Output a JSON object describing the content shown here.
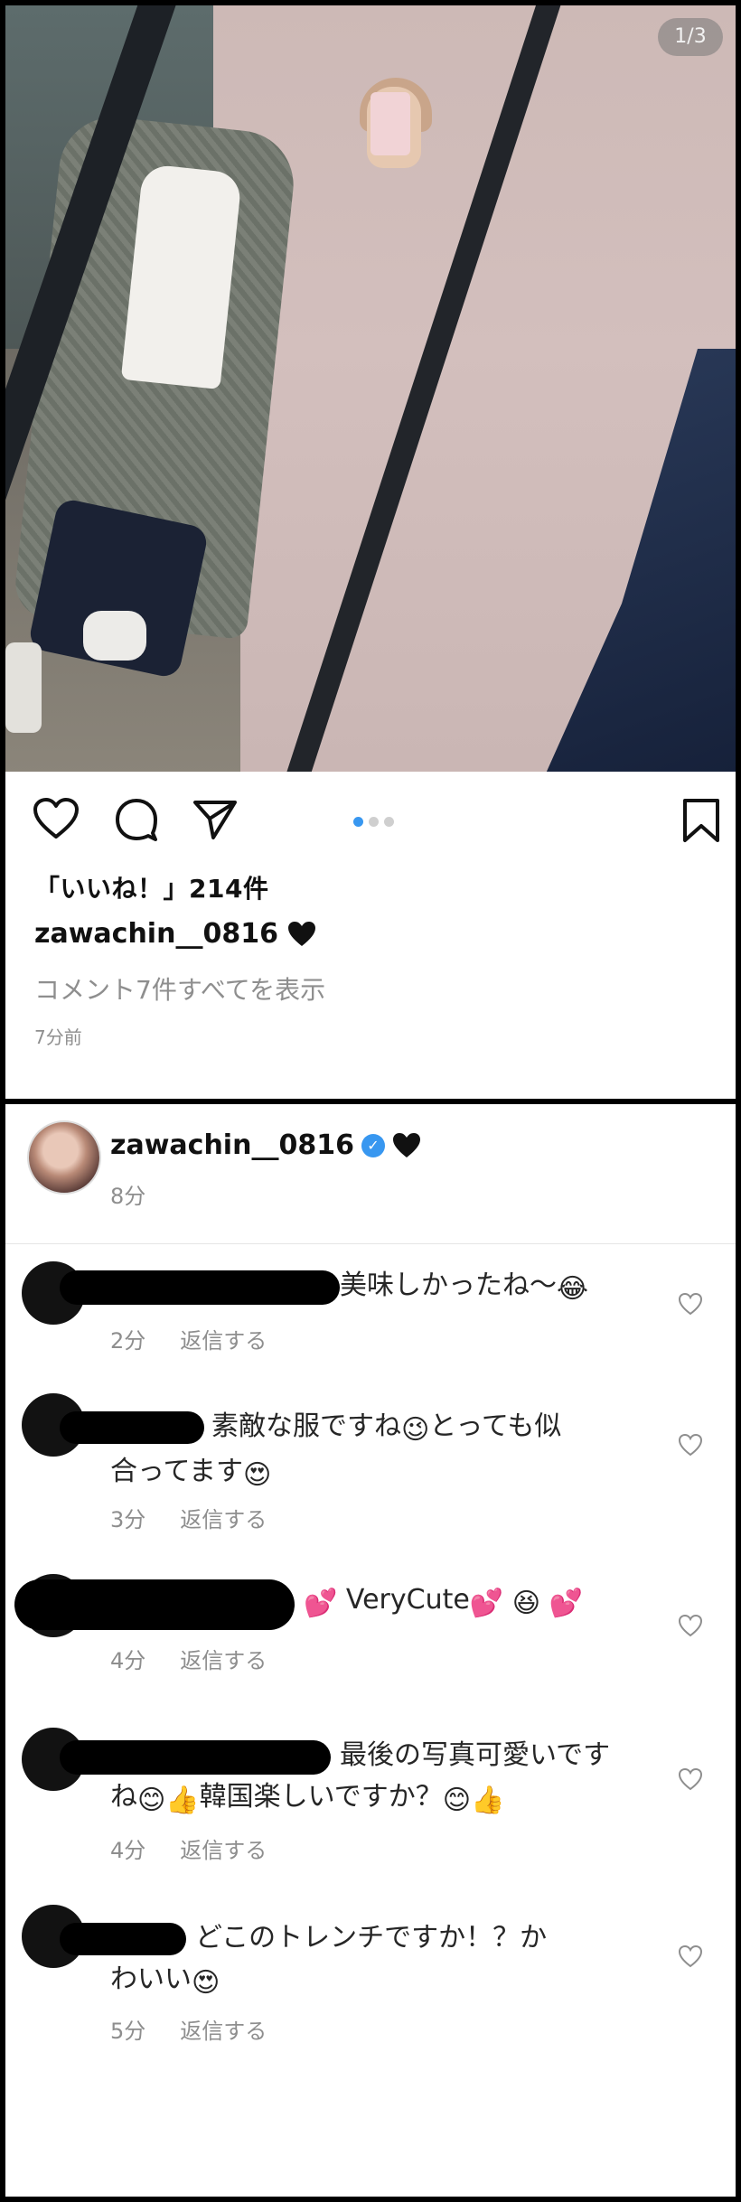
{
  "post": {
    "image_counter": "1/3",
    "carousel": {
      "total": 3,
      "active_index": 0
    },
    "likes_text": "「いいね！」214件",
    "caption_username": "zawachin__0816",
    "caption_emoji": "black-heart",
    "view_all_comments": "コメント7件すべてを表示",
    "time_ago": "7分前"
  },
  "comments_view": {
    "author": {
      "username": "zawachin__0816",
      "verified": true,
      "badge_emoji": "black-heart",
      "time": "8分"
    },
    "reply_label": "返信する",
    "comments": [
      {
        "text_before": "美味しかったね〜",
        "emojis": [
          "joy"
        ],
        "time": "2分"
      },
      {
        "text_line1": "素敵な服ですね",
        "text_line1_mid_emoji": "wink",
        "text_line1_after": "とっても似",
        "text_line2": "合ってます",
        "text_line2_emoji": "heart-eyes",
        "time": "3分"
      },
      {
        "text_before": "VeryCute",
        "emojis": [
          "two-hearts",
          "two-hearts",
          "laughing",
          "two-hearts"
        ],
        "time": "4分"
      },
      {
        "text_line1": "最後の写真可愛いです",
        "text_line2_a": "ね",
        "text_line2_b": "韓国楽しいですか？",
        "text_line2_emojis": [
          "smile",
          "thumbs-up",
          "smile",
          "thumbs-up"
        ],
        "time": "4分"
      },
      {
        "text_line1": "どこのトレンチですか！？か",
        "text_line2": "わいい",
        "text_line2_emoji": "heart-eyes",
        "time": "5分"
      }
    ]
  },
  "colors": {
    "accent": "#3897f0",
    "muted": "#8e8e8e",
    "text": "#262626"
  },
  "icons": [
    "heart-icon",
    "comment-icon",
    "share-icon",
    "bookmark-icon",
    "like-heart-icon",
    "verified-badge-icon"
  ]
}
